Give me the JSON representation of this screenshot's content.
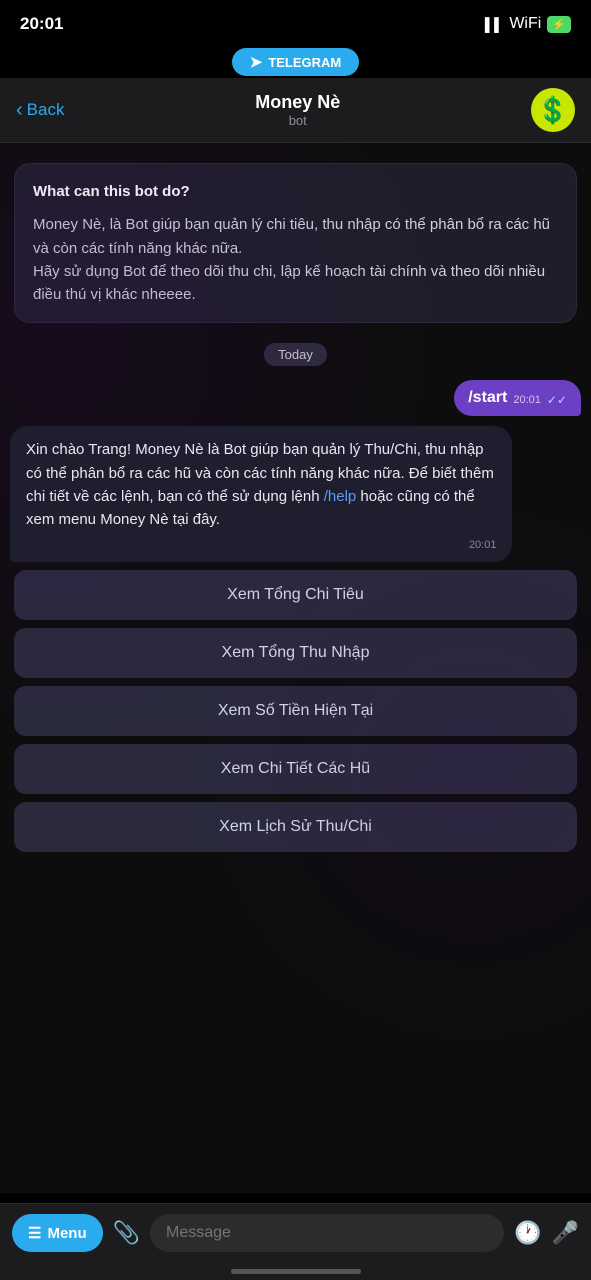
{
  "statusBar": {
    "time": "20:01",
    "telegramLabel": "TELEGRAM"
  },
  "header": {
    "backLabel": "Back",
    "title": "Money Nè",
    "subtitle": "bot",
    "avatarEmoji": "💲"
  },
  "infoCard": {
    "title": "What can this bot do?",
    "body": "Money Nè, là Bot giúp bạn quản lý chi tiêu, thu nhập có thể phân bổ ra các hũ và còn các tính năng khác nữa.\nHãy sử dụng Bot để theo dõi thu chi, lập kế hoạch tài chính và theo dõi nhiều điều thú vị khác nheeee."
  },
  "dateSep": "Today",
  "outMsg": {
    "text": "/start",
    "time": "20:01"
  },
  "inMsg": {
    "text1": "Xin chào Trang! Money Nè là Bot giúp bạn quản lý Thu/Chi, thu nhập có thể phân bổ ra các hũ và còn các tính năng khác nữa. Để biết thêm chi tiết về các lệnh, bạn có thể sử dụng lệnh ",
    "linkText": "/help",
    "text2": " hoặc cũng có thể xem menu Money Nè tại đây.",
    "time": "20:01"
  },
  "botButtons": [
    "Xem Tổng Chi Tiêu",
    "Xem Tổng Thu Nhập",
    "Xem Số Tiền Hiện Tại",
    "Xem Chi Tiết Các Hũ",
    "Xem Lịch Sử Thu/Chi"
  ],
  "inputBar": {
    "menuLabel": "Menu",
    "messagePlaceholder": "Message"
  }
}
